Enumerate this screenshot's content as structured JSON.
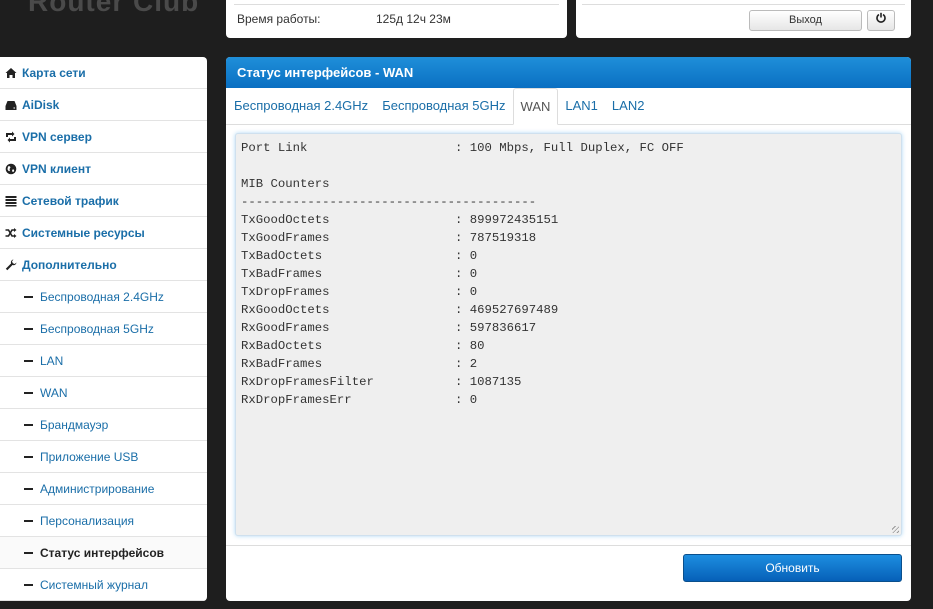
{
  "header": {
    "logo_text": "Router Club",
    "uptime_label": "Время работы:",
    "uptime_value": "125д 12ч 23м",
    "logout_label": "Выход",
    "power_icon": "power-icon"
  },
  "sidebar": {
    "items": [
      {
        "label": "Карта сети",
        "icon": "home-icon"
      },
      {
        "label": "AiDisk",
        "icon": "hdd-icon"
      },
      {
        "label": "VPN сервер",
        "icon": "retweet-icon"
      },
      {
        "label": "VPN клиент",
        "icon": "globe-icon"
      },
      {
        "label": "Сетевой трафик",
        "icon": "list-icon"
      },
      {
        "label": "Системные ресурсы",
        "icon": "random-icon"
      },
      {
        "label": "Дополнительно",
        "icon": "wrench-icon"
      }
    ],
    "sub_items": [
      {
        "label": "Беспроводная 2.4GHz"
      },
      {
        "label": "Беспроводная 5GHz"
      },
      {
        "label": "LAN"
      },
      {
        "label": "WAN"
      },
      {
        "label": "Брандмауэр"
      },
      {
        "label": "Приложение USB"
      },
      {
        "label": "Администрирование"
      },
      {
        "label": "Персонализация"
      },
      {
        "label": "Статус интерфейсов",
        "active": true
      },
      {
        "label": "Системный журнал"
      }
    ]
  },
  "main": {
    "title": "Статус интерфейсов - WAN",
    "tabs": [
      {
        "label": "Беспроводная 2.4GHz"
      },
      {
        "label": "Беспроводная 5GHz"
      },
      {
        "label": "WAN",
        "active": true
      },
      {
        "label": "LAN1"
      },
      {
        "label": "LAN2"
      }
    ],
    "log_text": "Port Link                    : 100 Mbps, Full Duplex, FC OFF\n\nMIB Counters\n----------------------------------------\nTxGoodOctets                 : 899972435151\nTxGoodFrames                 : 787519318\nTxBadOctets                  : 0\nTxBadFrames                  : 0\nTxDropFrames                 : 0\nRxGoodOctets                 : 469527697489\nRxGoodFrames                 : 597836617\nRxBadOctets                  : 80\nRxBadFrames                  : 2\nRxDropFramesFilter           : 1087135\nRxDropFramesErr              : 0",
    "refresh_label": "Обновить"
  },
  "colors": {
    "accent": "#0a6fc2",
    "link": "#1a6ea8",
    "background": "#1e1e1e"
  }
}
